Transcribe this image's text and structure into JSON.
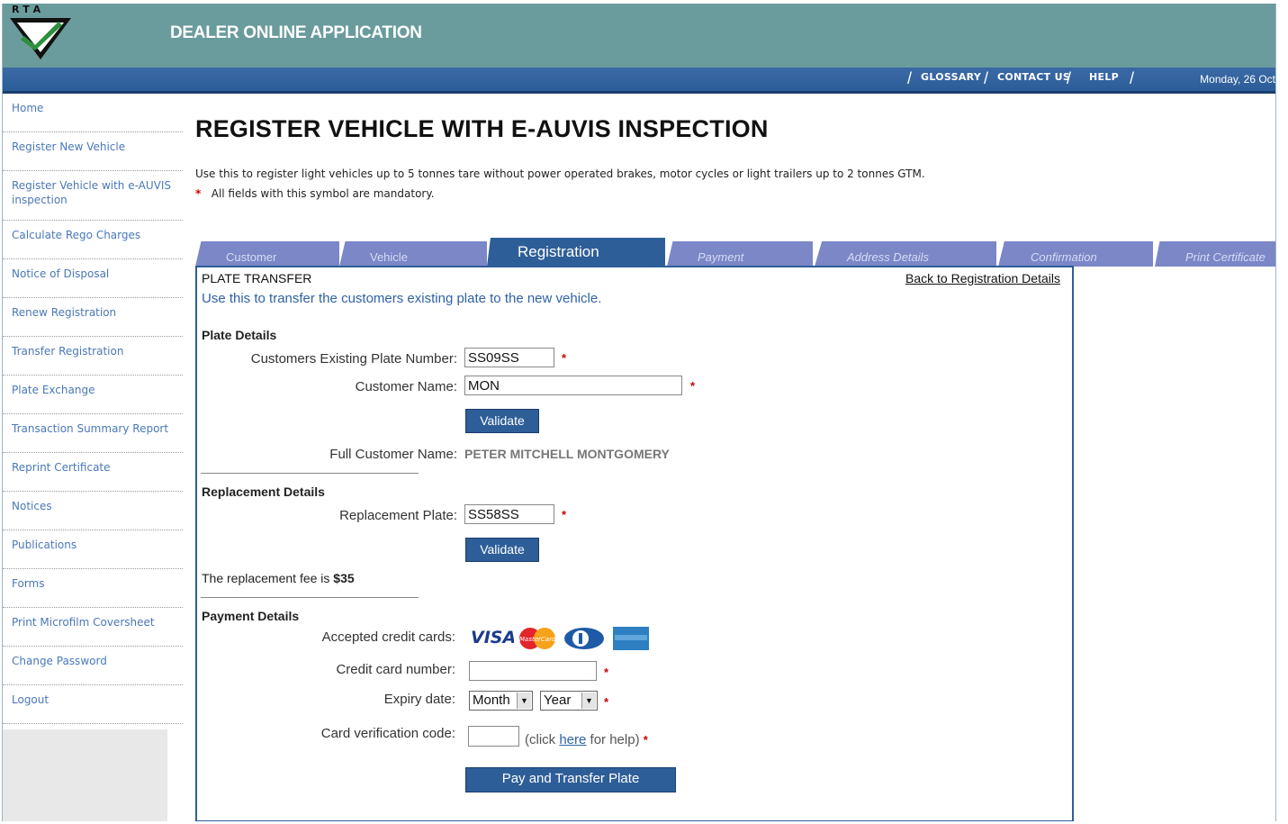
{
  "header": {
    "logo_text": "R T A",
    "app_title": "DEALER ONLINE APPLICATION",
    "nav": [
      "GLOSSARY",
      "CONTACT US",
      "HELP"
    ],
    "date": "Monday, 26 Oct"
  },
  "sidebar": {
    "items": [
      {
        "label": "Home"
      },
      {
        "label": "Register New Vehicle"
      },
      {
        "label": "Register Vehicle with e-AUVIS inspection"
      },
      {
        "label": "Calculate Rego Charges"
      },
      {
        "label": "Notice of Disposal"
      },
      {
        "label": "Renew Registration"
      },
      {
        "label": "Transfer Registration"
      },
      {
        "label": "Plate Exchange"
      },
      {
        "label": "Transaction Summary Report"
      },
      {
        "label": "Reprint Certificate"
      },
      {
        "label": "Notices"
      },
      {
        "label": "Publications"
      },
      {
        "label": "Forms"
      },
      {
        "label": "Print Microfilm Coversheet"
      },
      {
        "label": "Change Password"
      },
      {
        "label": "Logout"
      }
    ]
  },
  "page": {
    "title": "REGISTER VEHICLE WITH E-AUVIS INSPECTION",
    "description": "Use this to register light vehicles up to 5 tonnes tare without power operated brakes, motor cycles or light trailers up to 2 tonnes GTM.",
    "mandatory_note": "All fields with this symbol are mandatory.",
    "star": "*"
  },
  "tabs": [
    {
      "label": "Customer",
      "active": false
    },
    {
      "label": "Vehicle",
      "active": false
    },
    {
      "label": "Registration",
      "active": true
    },
    {
      "label": "Payment",
      "active": false
    },
    {
      "label": "Address Details",
      "active": false
    },
    {
      "label": "Confirmation",
      "active": false
    },
    {
      "label": "Print Certificate",
      "active": false
    }
  ],
  "panel": {
    "heading": "PLATE TRANSFER",
    "back_link": "Back to Registration Details",
    "intro": "Use this to transfer the customers existing plate to the new vehicle.",
    "plate_details": {
      "heading": "Plate Details",
      "plate_label": "Customers Existing Plate Number:",
      "plate_value": "SS09SS",
      "name_label": "Customer Name:",
      "name_value": "MON",
      "validate_label": "Validate",
      "full_name_label": "Full Customer Name:",
      "full_name_value": "PETER MITCHELL MONTGOMERY"
    },
    "replacement": {
      "heading": "Replacement Details",
      "plate_label": "Replacement Plate:",
      "plate_value": "SS58SS",
      "validate_label": "Validate",
      "fee_text": "The replacement fee is",
      "fee_value": "$35"
    },
    "payment": {
      "heading": "Payment Details",
      "cards_label": "Accepted credit cards:",
      "cards": [
        "VISA",
        "MasterCard",
        "Diners Club",
        "American Express"
      ],
      "card_number_label": "Credit card number:",
      "card_number_value": "",
      "expiry_label": "Expiry date:",
      "month_value": "Month",
      "year_value": "Year",
      "cvc_label": "Card verification code:",
      "cvc_value": "",
      "help_prefix": "(click",
      "help_link": "here",
      "help_suffix": "for help)",
      "submit_label": "Pay and Transfer Plate"
    }
  },
  "colors": {
    "header_teal": "#6a9b9d",
    "nav_blue": "#2e5e98",
    "tab_inactive": "#7b87c7",
    "link_blue": "#4a78b8",
    "mandatory_red": "#cc0000"
  }
}
